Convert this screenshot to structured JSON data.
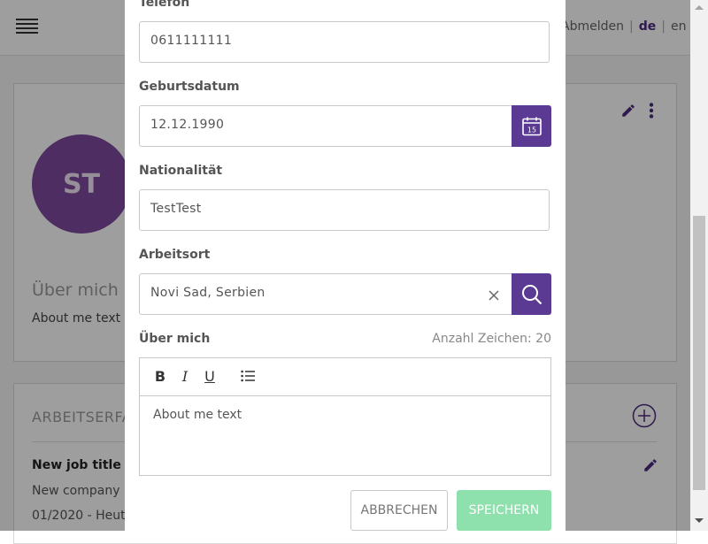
{
  "background": {
    "top_links": {
      "logout": "Abmelden",
      "lang_de": "de",
      "lang_en": "en"
    },
    "avatar_initials": "ST",
    "about_heading": "Über mich",
    "about_text": "About me text",
    "experience_heading": "ARBEITSERFA",
    "job": {
      "title": "New job title",
      "company": "New company",
      "dates": "01/2020 - Heut"
    }
  },
  "modal": {
    "phone": {
      "label": "Telefon",
      "value": "0611111111"
    },
    "birthdate": {
      "label": "Geburtsdatum",
      "value": "12.12.1990",
      "calendar_day": "15"
    },
    "nationality": {
      "label": "Nationalität",
      "value": "TestTest"
    },
    "workplace": {
      "label": "Arbeitsort",
      "value": "Novi Sad, Serbien"
    },
    "about": {
      "label": "Über mich",
      "counter": "Anzahl Zeichen: 20",
      "text": "About me text"
    },
    "editor_toolbar": {
      "bold": "B",
      "italic": "I",
      "underline": "U"
    },
    "buttons": {
      "cancel": "ABBRECHEN",
      "save": "SPEICHERN"
    }
  },
  "colors": {
    "primary": "#5a3a93",
    "save": "#8ee0ad",
    "avatar": "#7e4a9e"
  }
}
